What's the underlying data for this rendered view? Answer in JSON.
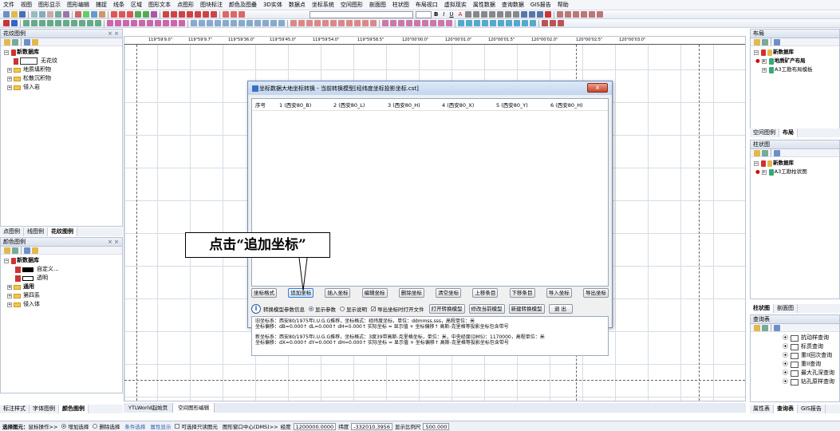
{
  "menubar": {
    "items": [
      "文件",
      "视图",
      "图形显示",
      "图形编辑",
      "捕捉",
      "线条",
      "区域",
      "图形文本",
      "点图形",
      "图块标注",
      "颜色及图叠",
      "3D实体",
      "数据点",
      "坐标系统",
      "空间图形",
      "剖面图",
      "柱状图",
      "布局视口",
      "虚拟现实",
      "属性数据",
      "查询数据",
      "GIS报告",
      "帮助"
    ]
  },
  "toolbar": {
    "fmt_bold": "B",
    "fmt_italic": "I",
    "fmt_underline": "U",
    "fmt_color": "A"
  },
  "left_panel_top": {
    "title": "花纹图例",
    "close": "× ×",
    "tree": {
      "root": "新数据库",
      "selected": "无花纹",
      "items": [
        "地质填积物",
        "松散沉积物",
        "侵入岩"
      ]
    }
  },
  "left_tabs_top": [
    "点图例",
    "线图例",
    "花纹图例"
  ],
  "left_panel_bottom": {
    "title": "颜色图例",
    "close": "× ×",
    "tree": {
      "root": "新数据库",
      "items": [
        "自定义...",
        "透明",
        "通用",
        "第四系",
        "侵入体"
      ]
    }
  },
  "left_tabs_bottom": [
    "标注样式",
    "字体图例",
    "颜色图例"
  ],
  "ruler": {
    "labels": [
      "119°59'9.0\"",
      "119°59'9.7\"",
      "119°59'36.0\"",
      "119°59'45.0\"",
      "119°59'54.0\"",
      "119°59'58.5\"",
      "120°00'00.0\"",
      "120°00'01.0\"",
      "120°00'01.5\"",
      "120°00'02.0\"",
      "120°00'02.5\"",
      "120°00'03.0\""
    ]
  },
  "dialog": {
    "title": "坐标数据大地坐标转换 - 当前转换模型[经纬度坐标投影坐标.cst]",
    "close": "x",
    "columns": [
      "序号",
      "1 (西安80_B)",
      "2 (西安80_L)",
      "3 (西安80_H)",
      "4 (西安80_X)",
      "5 (西安80_Y)",
      "6 (西安80_H)"
    ],
    "buttons": [
      "坐标格式",
      "追加坐标",
      "插入坐标",
      "编辑坐标",
      "删除坐标",
      "清空坐标",
      "上移条目",
      "下移条目",
      "导入坐标",
      "导出坐标"
    ],
    "opt_label": "转换模型参数信息",
    "opt_show_params": "显示参数",
    "opt_show_desc": "显示说明",
    "opt_open_file": "导出坐标时打开文件",
    "btn_open_model": "打开转换模型",
    "btn_modify_model": "修改当前模型",
    "btn_new_model": "新建转换模型",
    "btn_exit": "退 出",
    "info_lines": [
      "旧坐标系：西安80/1975年I.U.G.G推荐，坐标格式：经纬度坐标，单位：ddmmss.sss，高程单位：米",
      "坐标偏移：dB=0.000↑ dL=0.000↑ dH=0.000↑ 实际坐标 = 显示值 + 坐标偏移↑ 高斯-克里格等投影坐标包含带号",
      "新坐标系：西安80/1975年I.U.G.G推荐，坐标格式：3度39带高斯-克里格坐标，单位：米，中央经度(DMS)：1170000，高程单位：米",
      "坐标偏移：dX=0.000↑ dY=0.000↑ dH=0.000↑ 实际坐标 = 显示值 + 坐标偏移↑ 高斯-克里格等投影坐标包含带号"
    ]
  },
  "callout": {
    "text": "点击“追加坐标”"
  },
  "right_panel_top": {
    "title": "布局",
    "tree": {
      "root": "新数据库",
      "items": [
        "地质矿产布局",
        "A3工勘布局模板"
      ]
    }
  },
  "right_tabs_top": [
    "空间图例",
    "布局"
  ],
  "right_panel_mid": {
    "title": "柱状图",
    "tree": {
      "root": "新数据库",
      "items": [
        "A3工勘柱状图"
      ]
    }
  },
  "right_tabs_mid": [
    "柱状图",
    "剖面图"
  ],
  "right_panel_bottom": {
    "title": "查询表",
    "items": [
      "抗动样查询",
      "标贯查询",
      "重II回次查询",
      "重II查询",
      "最大孔深查询",
      "钻孔原样查询"
    ]
  },
  "right_tabs_bottom": [
    "属性表",
    "查询表",
    "GIS报告"
  ],
  "doc_tabs": [
    "YTLWorld起始页",
    "空间图形编辑"
  ],
  "statusbar": {
    "label": "选择图元：",
    "mode": "鼠标操作>>",
    "opt_add": "增加选择",
    "opt_del": "删除选择",
    "cond": "条件选择",
    "attr": "属性显示",
    "readonly": "可选择只读图元",
    "center_label": "图形窗口中心(DMS)>>",
    "lon_label": "经度",
    "lon_value": "1200000.0000",
    "lat_label": "纬度",
    "lat_value": "-332010.3956",
    "scale_label": "显示比例尺",
    "scale_value": "500.000"
  }
}
